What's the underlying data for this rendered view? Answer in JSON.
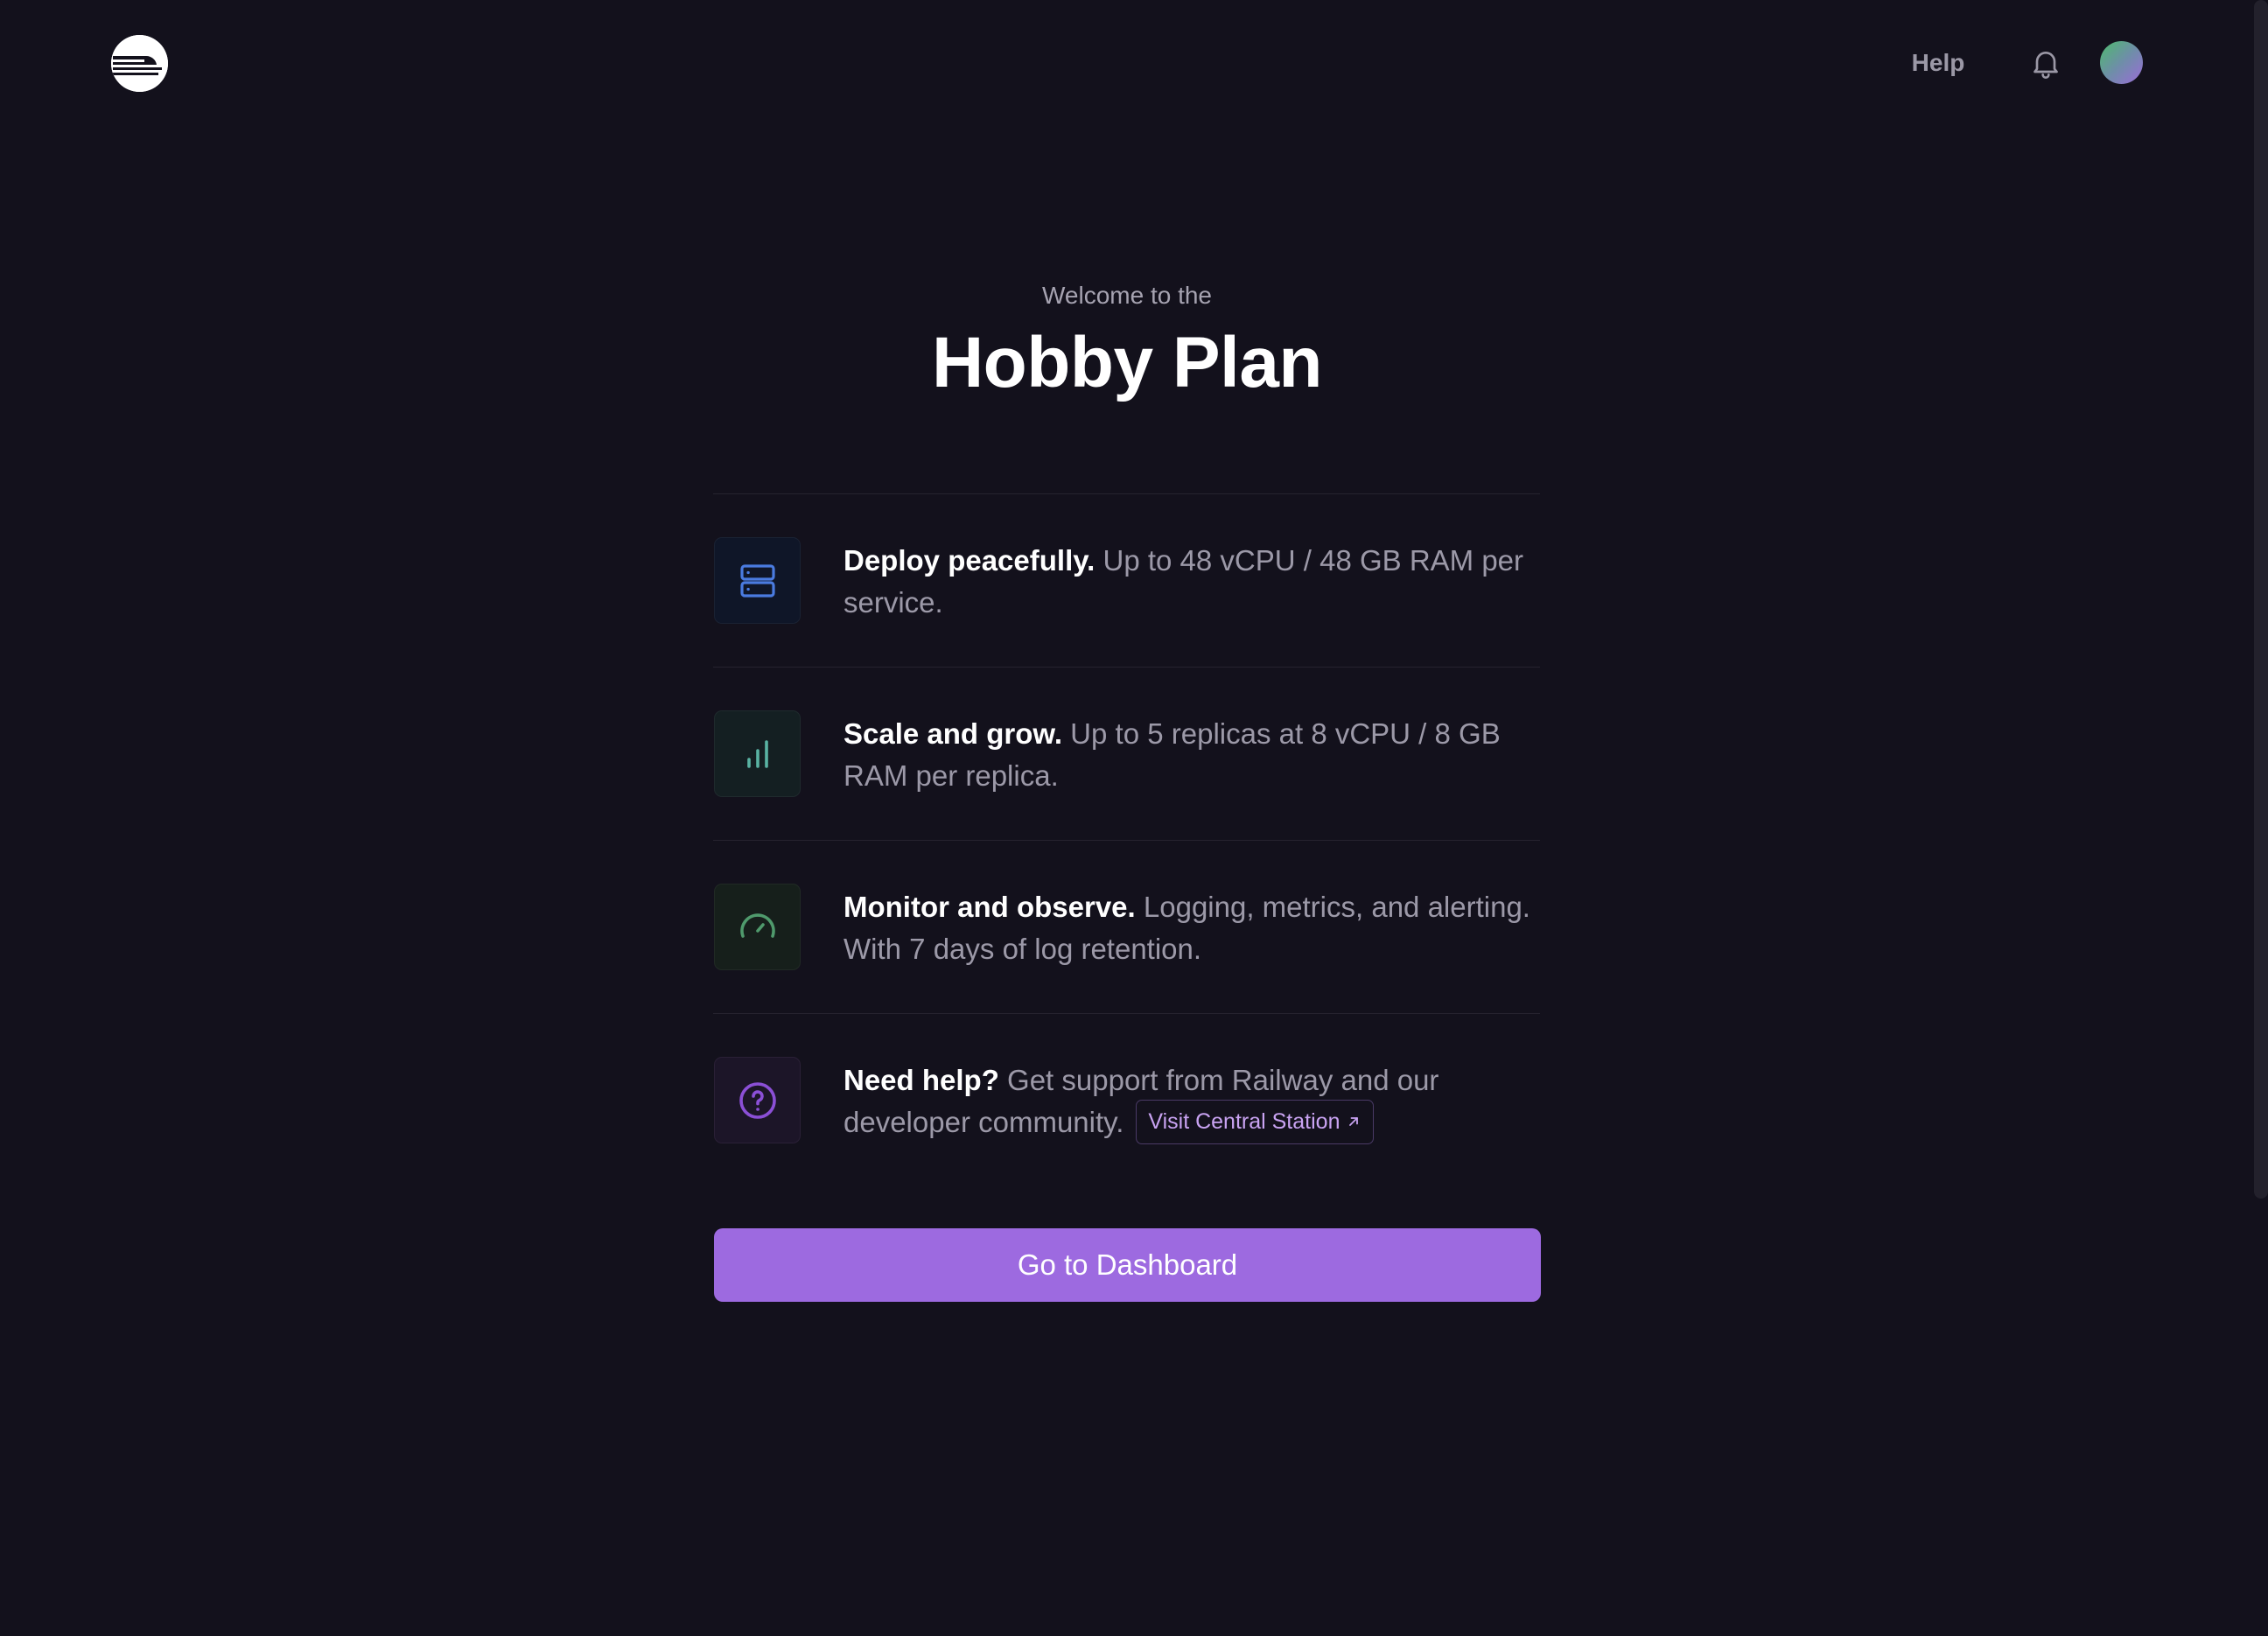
{
  "header": {
    "logo_icon": "railway-logo-icon",
    "help_label": "Help",
    "notifications_icon": "bell-icon",
    "avatar_icon": "user-avatar"
  },
  "hero": {
    "eyebrow": "Welcome to the",
    "title": "Hobby Plan"
  },
  "features": [
    {
      "icon": "server-icon",
      "accent": "#4a7be0",
      "heading": "Deploy peacefully.",
      "body": " Up to 48 vCPU / 48 GB RAM per service."
    },
    {
      "icon": "bar-chart-icon",
      "accent": "#59b3a3",
      "heading": "Scale and grow.",
      "body": " Up to 5 replicas at 8 vCPU / 8 GB RAM per replica."
    },
    {
      "icon": "gauge-icon",
      "accent": "#4f9a6c",
      "heading": "Monitor and observe.",
      "body": " Logging, metrics, and alerting. With 7 days of log retention."
    },
    {
      "icon": "help-circle-icon",
      "accent": "#8b4fd6",
      "heading": "Need help?",
      "body": " Get support from Railway and our developer community.",
      "link_label": "Visit Central Station",
      "link_icon": "external-arrow-icon"
    }
  ],
  "cta": {
    "label": "Go to Dashboard",
    "color": "#9d6ae0"
  },
  "colors": {
    "background": "#13111c",
    "divider": "#26232f",
    "muted_text": "#9c99a8"
  }
}
